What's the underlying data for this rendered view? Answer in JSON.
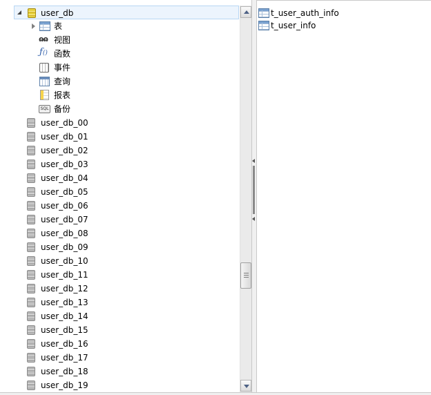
{
  "tree": {
    "root": {
      "label": "user_db",
      "icon": "database-yellow-icon",
      "expanded": true
    },
    "children": [
      {
        "label": "表",
        "icon": "table-icon",
        "has_expander": true
      },
      {
        "label": "视图",
        "icon": "view-icon",
        "glyph": "ɷɷ"
      },
      {
        "label": "函数",
        "icon": "function-icon",
        "glyph": "f(x)"
      },
      {
        "label": "事件",
        "icon": "event-icon"
      },
      {
        "label": "查询",
        "icon": "query-icon"
      },
      {
        "label": "报表",
        "icon": "report-icon"
      },
      {
        "label": "备份",
        "icon": "backup-icon",
        "glyph": "SQL"
      }
    ],
    "databases": [
      "user_db_00",
      "user_db_01",
      "user_db_02",
      "user_db_03",
      "user_db_04",
      "user_db_05",
      "user_db_06",
      "user_db_07",
      "user_db_08",
      "user_db_09",
      "user_db_10",
      "user_db_11",
      "user_db_12",
      "user_db_13",
      "user_db_14",
      "user_db_15",
      "user_db_16",
      "user_db_17",
      "user_db_18",
      "user_db_19"
    ]
  },
  "right_pane": {
    "items": [
      {
        "label": "t_user_auth_info",
        "icon": "table-icon"
      },
      {
        "label": "t_user_info",
        "icon": "table-icon"
      }
    ]
  },
  "colors": {
    "selection_bg": "#ecf4fd",
    "selection_border": "#b8d6f3",
    "db_icon_gray": "#b9b9b9",
    "db_icon_yellow": "#e6d040"
  }
}
